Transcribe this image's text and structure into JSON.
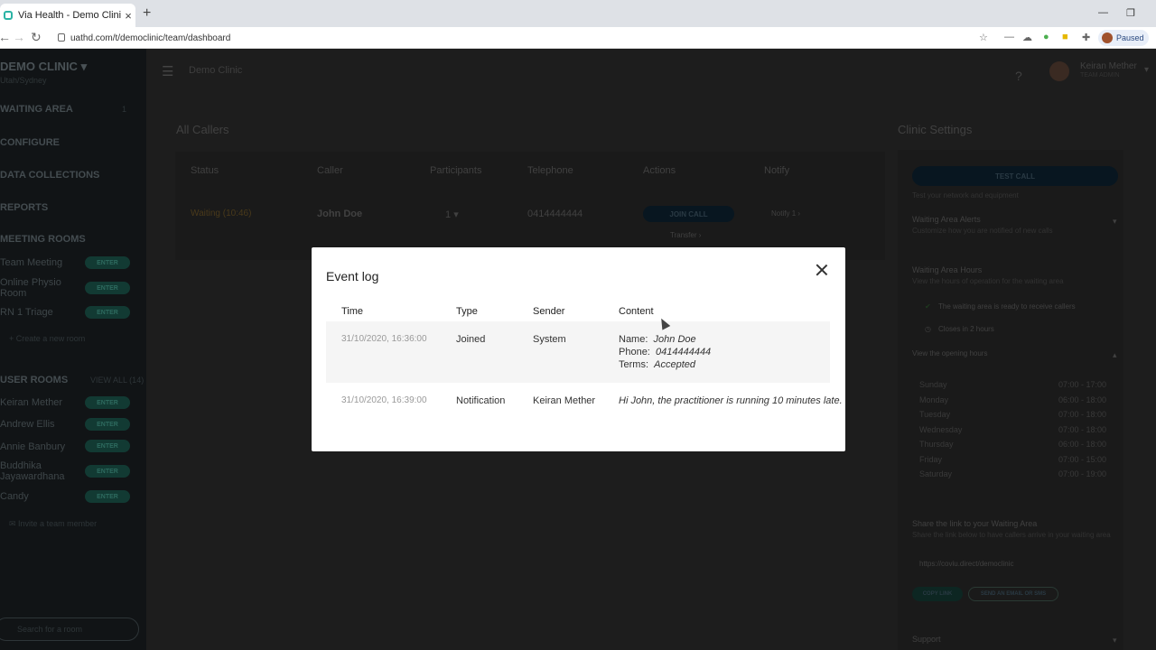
{
  "browser": {
    "tab_title": "Via Health - Demo Clinic",
    "url": "uathd.com/t/democlinic/team/dashboard",
    "paused_label": "Paused",
    "icons": [
      "back-arrow-icon",
      "forward-arrow-icon",
      "reload-icon",
      "star-icon",
      "extensions-icon"
    ]
  },
  "sidebar": {
    "clinic_name": "DEMO CLINIC",
    "clinic_sub": "Utah/Sydney",
    "waiting_area": "WAITING AREA",
    "waiting_count": "1",
    "configure": "CONFIGURE",
    "data_collections": "DATA COLLECTIONS",
    "reports": "REPORTS",
    "meeting_rooms": "MEETING ROOMS",
    "rooms": [
      "Team Meeting",
      "Online Physio Room",
      "RN 1 Triage"
    ],
    "create_room": "Create a new room",
    "user_rooms": "USER ROOMS",
    "view_all": "VIEW ALL (14)",
    "users": [
      "Keiran Mether",
      "Andrew Ellis",
      "Annie Banbury",
      "Buddhika Jayawardhana",
      "Candy"
    ],
    "enter_label": "ENTER",
    "invite": "Invite a team member",
    "search_placeholder": "Search for a room"
  },
  "header": {
    "clinic_title": "Demo Clinic",
    "user_name": "Keiran Mether",
    "user_role": "TEAM ADMIN"
  },
  "callers": {
    "title": "All Callers",
    "columns": [
      "Status",
      "Caller",
      "Participants",
      "Telephone",
      "Actions",
      "Notify"
    ],
    "row": {
      "status": "Waiting (10:46)",
      "caller": "John Doe",
      "participants": "1",
      "telephone": "0414444444",
      "join": "JOIN CALL",
      "transfer": "Transfer",
      "notify": "Notify",
      "notify_count": "1"
    }
  },
  "settings": {
    "title": "Clinic Settings",
    "test_call": "TEST CALL",
    "test_sub": "Test your network and equipment",
    "alerts_title": "Waiting Area Alerts",
    "alerts_sub": "Customize how you are notified of new calls",
    "hours_title": "Waiting Area Hours",
    "hours_sub": "View the hours of operation for the waiting area",
    "ready": "The waiting area is ready to receive callers",
    "closes": "Closes in 2 hours",
    "view_hours": "View the opening hours",
    "hours": [
      [
        "Sunday",
        "07:00 - 17:00"
      ],
      [
        "Monday",
        "06:00 - 18:00"
      ],
      [
        "Tuesday",
        "07:00 - 18:00"
      ],
      [
        "Wednesday",
        "07:00 - 18:00"
      ],
      [
        "Thursday",
        "06:00 - 18:00"
      ],
      [
        "Friday",
        "07:00 - 15:00"
      ],
      [
        "Saturday",
        "07:00 - 19:00"
      ]
    ],
    "share_title": "Share the link to your Waiting Area",
    "share_sub": "Share the link below to have callers arrive in your waiting area",
    "share_link": "https://coviu.direct/democlinic",
    "copy_link": "COPY LINK",
    "send_invite": "SEND AN EMAIL OR SMS",
    "support": "Support"
  },
  "modal": {
    "title": "Event log",
    "columns": {
      "time": "Time",
      "type": "Type",
      "sender": "Sender",
      "content": "Content"
    },
    "rows": [
      {
        "time": "31/10/2020, 16:36:00",
        "type": "Joined",
        "sender": "System",
        "name_label": "Name:",
        "name_value": "John Doe",
        "phone_label": "Phone:",
        "phone_value": "0414444444",
        "terms_label": "Terms:",
        "terms_value": "Accepted"
      },
      {
        "time": "31/10/2020, 16:39:00",
        "type": "Notification",
        "sender": "Keiran Mether",
        "message": "Hi John, the practitioner is running 10 minutes late."
      }
    ]
  }
}
